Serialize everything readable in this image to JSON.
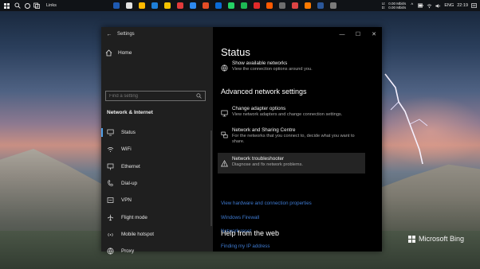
{
  "taskbar": {
    "links_label": "Links",
    "net_speed_up": "0.00 Mbit/s",
    "net_speed_down": "0.00 Mbit/s",
    "ud_u": "U:",
    "ud_d": "D:",
    "language": "ENG",
    "time": "22:19",
    "app_colors": [
      "#1e5ab3",
      "#e2e2e2",
      "#ffb900",
      "#1e7fd8",
      "#f2c200",
      "#e23b3b",
      "#2d89ef",
      "#e44d26",
      "#0b6bd6",
      "#25d366",
      "#1db954",
      "#e22a2a",
      "#ff5a00",
      "#6e6e6e",
      "#d44",
      "#ff7a00",
      "#2b579a",
      "#7b7b7b"
    ]
  },
  "settings": {
    "title": "Settings",
    "back_icon": "back-arrow-icon",
    "home": "Home",
    "search_placeholder": "Find a setting",
    "section": "Network & Internet",
    "nav": [
      {
        "label": "Status",
        "icon": "status-icon",
        "active": true
      },
      {
        "label": "WiFi",
        "icon": "wifi-icon",
        "active": false
      },
      {
        "label": "Ethernet",
        "icon": "ethernet-icon",
        "active": false
      },
      {
        "label": "Dial-up",
        "icon": "dialup-icon",
        "active": false
      },
      {
        "label": "VPN",
        "icon": "vpn-icon",
        "active": false
      },
      {
        "label": "Flight mode",
        "icon": "flight-mode-icon",
        "active": false
      },
      {
        "label": "Mobile hotspot",
        "icon": "mobile-hotspot-icon",
        "active": false
      },
      {
        "label": "Proxy",
        "icon": "proxy-icon",
        "active": false
      }
    ],
    "content": {
      "title": "Status",
      "show_networks_title": "Show available networks",
      "show_networks_desc": "View the connection options around you.",
      "advanced_heading": "Advanced network settings",
      "adapter_title": "Change adapter options",
      "adapter_desc": "View network adapters and change connection settings.",
      "sharing_title": "Network and Sharing Centre",
      "sharing_desc1": "For the networks that you connect to, decide what you want to",
      "sharing_desc2": "share.",
      "troubleshooter_title": "Network troubleshooter",
      "troubleshooter_desc": "Diagnose and fix network problems.",
      "link_hardware": "View hardware and connection properties",
      "link_firewall": "Windows Firewall",
      "link_reset": "Network reset",
      "help_heading": "Help from the web",
      "link_ip": "Finding my IP address"
    }
  },
  "wallpaper": {
    "brand": "Microsoft Bing"
  },
  "colors": {
    "accent": "#4f9fe6",
    "link": "#3e7ad1",
    "left_pane": "#1f1f1f",
    "right_pane": "#000000"
  }
}
